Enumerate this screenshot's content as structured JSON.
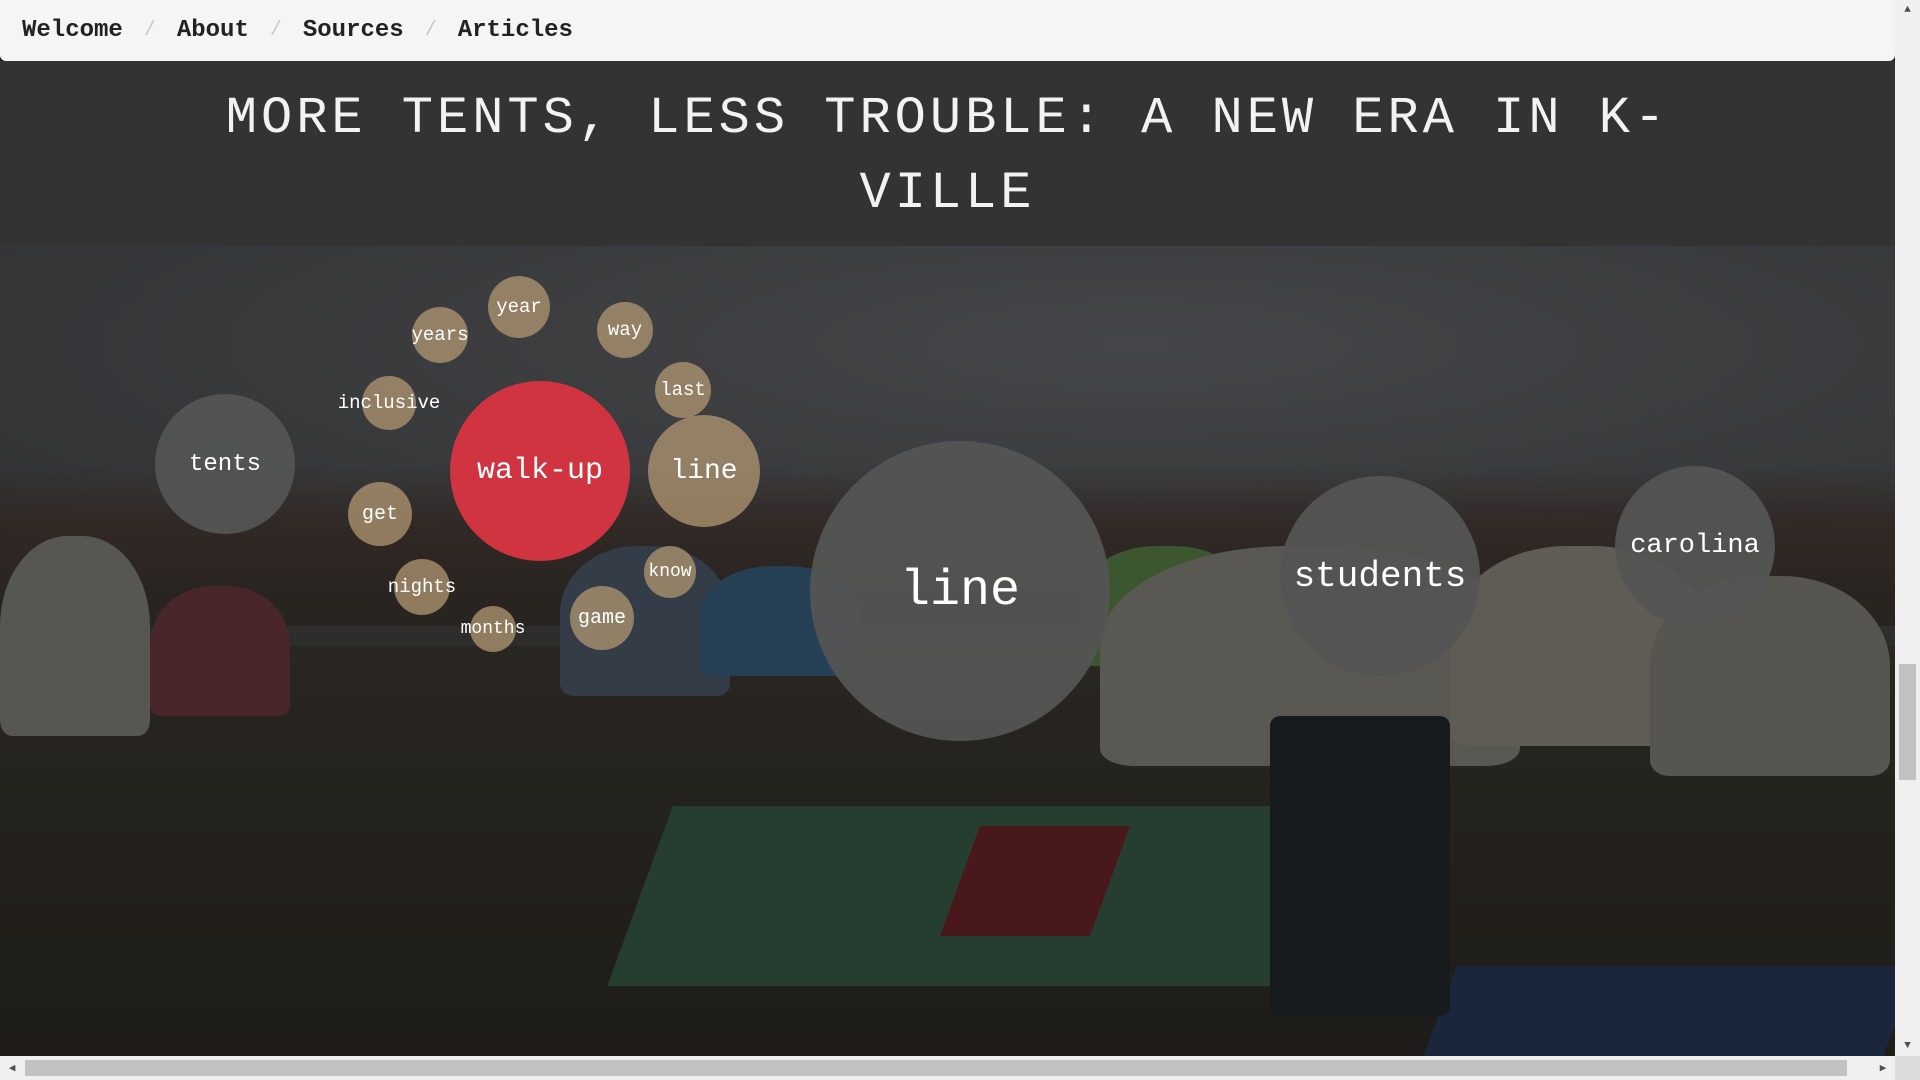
{
  "breadcrumb": {
    "items": [
      "Welcome",
      "About",
      "Sources",
      "Articles"
    ],
    "separator": "/"
  },
  "page": {
    "title": "MORE TENTS, LESS TROUBLE: A NEW ERA IN K-VILLE"
  },
  "colors": {
    "bubble_gray": "#545454",
    "bubble_tan": "#ad9470",
    "bubble_selected": "#cf3440",
    "title_band": "#333333",
    "navbar": "#f5f5f5"
  },
  "bubbles": {
    "tents": "tents",
    "walkup": "walk-up",
    "line_small": "line",
    "line_big": "line",
    "students": "students",
    "carolina": "carolina",
    "year": "year",
    "years": "years",
    "way": "way",
    "last": "last",
    "inclusive": "inclusive",
    "get": "get",
    "nights": "nights",
    "months": "months",
    "know": "know",
    "game": "game"
  },
  "icons": {
    "scroll_up": "arrow-up-icon",
    "scroll_down": "arrow-down-icon",
    "scroll_left": "arrow-left-icon",
    "scroll_right": "arrow-right-icon"
  }
}
